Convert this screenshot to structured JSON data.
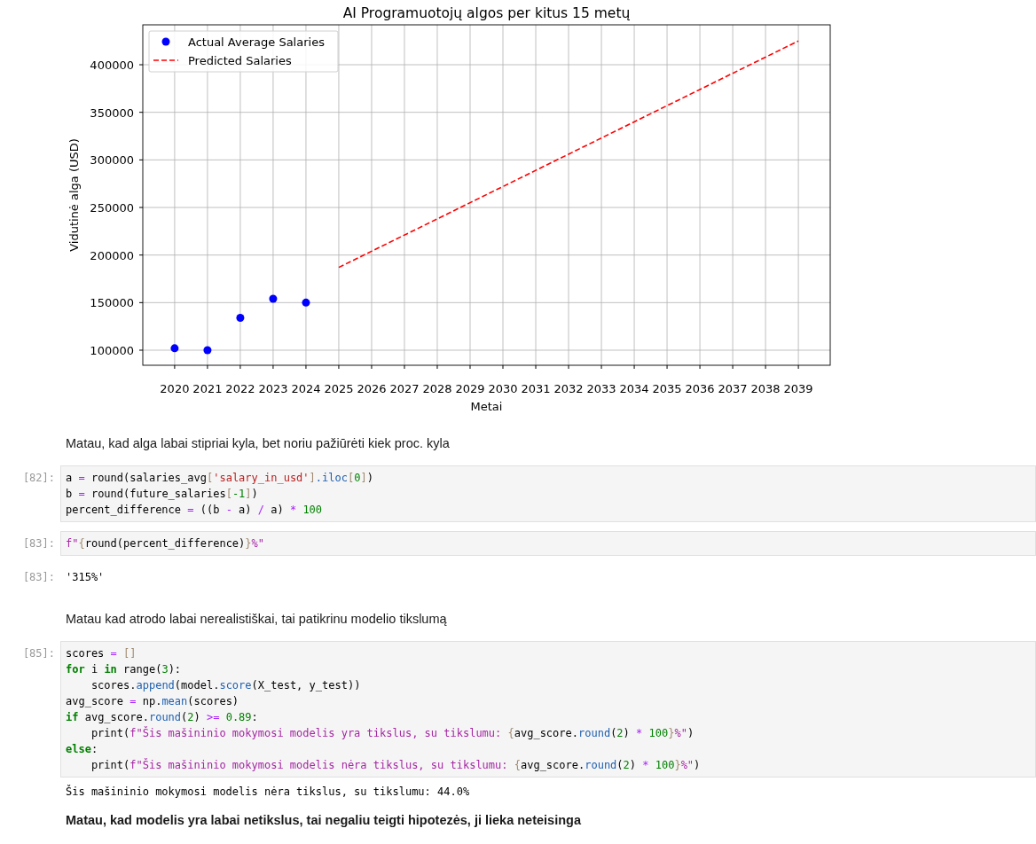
{
  "chart": {
    "chart_data": {
      "type": "line",
      "title": "AI Programuotojų algos per kitus 15 metų",
      "xlabel": "Metai",
      "ylabel": "Vidutinė alga (USD)",
      "x": [
        2020,
        2021,
        2022,
        2023,
        2024,
        2025,
        2026,
        2027,
        2028,
        2029,
        2030,
        2031,
        2032,
        2033,
        2034,
        2035,
        2036,
        2037,
        2038,
        2039
      ],
      "xlim": [
        2019.03,
        2039.97
      ],
      "ylim": [
        84160,
        441950
      ],
      "grid": true,
      "legend": "upper left",
      "xticks": [
        2020,
        2021,
        2022,
        2023,
        2024,
        2025,
        2026,
        2027,
        2028,
        2029,
        2030,
        2031,
        2032,
        2033,
        2034,
        2035,
        2036,
        2037,
        2038,
        2039
      ],
      "yticks": [
        100000,
        150000,
        200000,
        250000,
        300000,
        350000,
        400000
      ],
      "series": [
        {
          "name": "Actual Average Salaries",
          "type": "scatter",
          "color": "#0000ff",
          "values": [
            102000,
            100000,
            134000,
            154000,
            150000,
            null,
            null,
            null,
            null,
            null,
            null,
            null,
            null,
            null,
            null,
            null,
            null,
            null,
            null,
            null
          ]
        },
        {
          "name": "Predicted Salaries",
          "type": "line",
          "line_style": "dashed",
          "color": "#ff0000",
          "values": [
            null,
            null,
            null,
            null,
            null,
            187000,
            204000,
            221000,
            238000,
            255000,
            272000,
            289000,
            306000,
            323000,
            340000,
            357000,
            374000,
            391000,
            408000,
            425000
          ]
        }
      ]
    }
  },
  "cells": [
    {
      "kind": "markdown",
      "bold": false,
      "text": "Matau, kad alga labai stipriai kyla, bet noriu pažiūrėti kiek proc. kyla"
    },
    {
      "kind": "code",
      "prompt": "[82]:",
      "lines": [
        [
          {
            "kind": "p",
            "text": "a "
          },
          {
            "kind": "o",
            "text": "="
          },
          {
            "kind": "p",
            "text": " round(salaries_avg"
          },
          {
            "kind": "b",
            "text": "["
          },
          {
            "kind": "s",
            "text": "'salary_in_usd'"
          },
          {
            "kind": "b",
            "text": "]"
          },
          {
            "kind": "a",
            "text": ".iloc"
          },
          {
            "kind": "b",
            "text": "["
          },
          {
            "kind": "n",
            "text": "0"
          },
          {
            "kind": "b",
            "text": "]"
          },
          {
            "kind": "p",
            "text": ")"
          }
        ],
        [
          {
            "kind": "p",
            "text": "b "
          },
          {
            "kind": "o",
            "text": "="
          },
          {
            "kind": "p",
            "text": " round(future_salaries"
          },
          {
            "kind": "b",
            "text": "["
          },
          {
            "kind": "n",
            "text": "-1"
          },
          {
            "kind": "b",
            "text": "]"
          },
          {
            "kind": "p",
            "text": ")"
          }
        ],
        [
          {
            "kind": "p",
            "text": "percent_difference "
          },
          {
            "kind": "o",
            "text": "="
          },
          {
            "kind": "p",
            "text": " ((b "
          },
          {
            "kind": "o",
            "text": "-"
          },
          {
            "kind": "p",
            "text": " a) "
          },
          {
            "kind": "o",
            "text": "/"
          },
          {
            "kind": "p",
            "text": " a) "
          },
          {
            "kind": "o",
            "text": "* "
          },
          {
            "kind": "n",
            "text": "100"
          }
        ]
      ]
    },
    {
      "kind": "code",
      "prompt": "[83]:",
      "lines": [
        [
          {
            "kind": "f",
            "text": "f\""
          },
          {
            "kind": "b",
            "text": "{"
          },
          {
            "kind": "p",
            "text": "round(percent_difference)"
          },
          {
            "kind": "b",
            "text": "}"
          },
          {
            "kind": "f",
            "text": "%\""
          }
        ]
      ]
    },
    {
      "kind": "output",
      "prompt": "[83]:",
      "text": "'315%'"
    },
    {
      "kind": "markdown",
      "bold": false,
      "text": "Matau kad atrodo labai nerealistiškai, tai patikrinu modelio tikslumą"
    },
    {
      "kind": "code",
      "prompt": "[85]:",
      "lines": [
        [
          {
            "kind": "p",
            "text": "scores "
          },
          {
            "kind": "o",
            "text": "= "
          },
          {
            "kind": "b",
            "text": "[]"
          }
        ],
        [
          {
            "kind": "k",
            "text": "for"
          },
          {
            "kind": "p",
            "text": " i "
          },
          {
            "kind": "k",
            "text": "in"
          },
          {
            "kind": "p",
            "text": " range("
          },
          {
            "kind": "n",
            "text": "3"
          },
          {
            "kind": "p",
            "text": "):"
          }
        ],
        [
          {
            "kind": "p",
            "text": "    scores."
          },
          {
            "kind": "a",
            "text": "append"
          },
          {
            "kind": "p",
            "text": "(model."
          },
          {
            "kind": "a",
            "text": "score"
          },
          {
            "kind": "p",
            "text": "(X_test, y_test))"
          }
        ],
        [
          {
            "kind": "p",
            "text": "avg_score "
          },
          {
            "kind": "o",
            "text": "="
          },
          {
            "kind": "p",
            "text": " np."
          },
          {
            "kind": "a",
            "text": "mean"
          },
          {
            "kind": "p",
            "text": "(scores)"
          }
        ],
        [
          {
            "kind": "k",
            "text": "if"
          },
          {
            "kind": "p",
            "text": " avg_score."
          },
          {
            "kind": "a",
            "text": "round"
          },
          {
            "kind": "p",
            "text": "("
          },
          {
            "kind": "n",
            "text": "2"
          },
          {
            "kind": "p",
            "text": ") "
          },
          {
            "kind": "o",
            "text": ">= "
          },
          {
            "kind": "n",
            "text": "0.89"
          },
          {
            "kind": "p",
            "text": ":"
          }
        ],
        [
          {
            "kind": "p",
            "text": "    print("
          },
          {
            "kind": "f",
            "text": "f\"Šis mašininio mokymosi modelis yra tikslus, su tikslumu: "
          },
          {
            "kind": "b",
            "text": "{"
          },
          {
            "kind": "p",
            "text": "avg_score."
          },
          {
            "kind": "a",
            "text": "round"
          },
          {
            "kind": "p",
            "text": "("
          },
          {
            "kind": "n",
            "text": "2"
          },
          {
            "kind": "p",
            "text": ") "
          },
          {
            "kind": "o",
            "text": "* "
          },
          {
            "kind": "n",
            "text": "100"
          },
          {
            "kind": "b",
            "text": "}"
          },
          {
            "kind": "f",
            "text": "%\""
          },
          {
            "kind": "p",
            "text": ")"
          }
        ],
        [
          {
            "kind": "k",
            "text": "else"
          },
          {
            "kind": "p",
            "text": ":"
          }
        ],
        [
          {
            "kind": "p",
            "text": "    print("
          },
          {
            "kind": "f",
            "text": "f\"Šis mašininio mokymosi modelis nėra tikslus, su tikslumu: "
          },
          {
            "kind": "b",
            "text": "{"
          },
          {
            "kind": "p",
            "text": "avg_score."
          },
          {
            "kind": "a",
            "text": "round"
          },
          {
            "kind": "p",
            "text": "("
          },
          {
            "kind": "n",
            "text": "2"
          },
          {
            "kind": "p",
            "text": ") "
          },
          {
            "kind": "o",
            "text": "* "
          },
          {
            "kind": "n",
            "text": "100"
          },
          {
            "kind": "b",
            "text": "}"
          },
          {
            "kind": "f",
            "text": "%\""
          },
          {
            "kind": "p",
            "text": ")"
          }
        ]
      ]
    },
    {
      "kind": "stream",
      "text": "Šis mašininio mokymosi modelis nėra tikslus, su tikslumu: 44.0%"
    },
    {
      "kind": "markdown",
      "bold": true,
      "text": "Matau, kad modelis yra labai netikslus, tai negaliu teigti hipotezės, ji lieka neteisinga"
    }
  ]
}
